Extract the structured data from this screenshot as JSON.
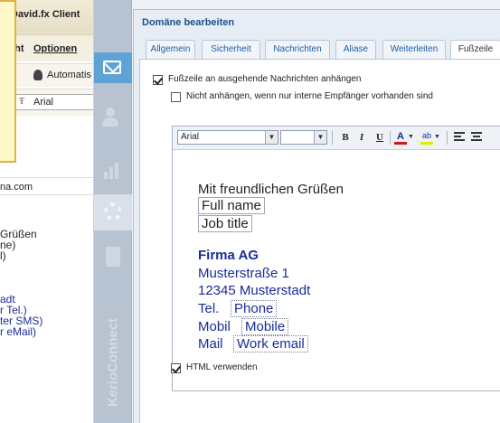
{
  "background_window": {
    "title": "David.fx Client",
    "menu": [
      "cht",
      "Optionen"
    ],
    "toolbar_label": "Automatis",
    "font_name": "Arial",
    "email_fragment": "na.com",
    "body_lines": [
      "Grüßen",
      "ne)",
      "l)",
      "adt",
      "r Tel.)",
      "ter SMS)",
      "r eMail)"
    ]
  },
  "nav": {
    "icons": [
      "mail-icon",
      "users-icon",
      "statistics-icon",
      "settings-icon",
      "documents-icon"
    ],
    "brand": "KerioConnect"
  },
  "dialog": {
    "title": "Domäne bearbeiten",
    "tabs": [
      "Allgemein",
      "Sicherheit",
      "Nachrichten",
      "Aliase",
      "Weiterleiten",
      "Fußzeile"
    ],
    "active_tab": "Fußzeile",
    "append_footer": {
      "label": "Fußzeile an ausgehende Nachrichten anhängen",
      "checked": true
    },
    "skip_internal": {
      "label": "Nicht anhängen, wenn nur interne Empfänger vorhanden sind",
      "checked": false
    },
    "use_html": {
      "label": "HTML verwenden",
      "checked": true
    }
  },
  "editor": {
    "font_select": "Arial",
    "size_select": "",
    "buttons": {
      "bold": "B",
      "italic": "I",
      "underline": "U",
      "font_color": "A",
      "highlight": "ab"
    },
    "greeting": "Mit freundlichen Grüßen",
    "full_name": "Full name",
    "job_title": "Job title",
    "company": "Firma AG",
    "street": "Musterstraße 1",
    "city": "12345 Musterstadt",
    "tel_label": "Tel.",
    "tel_value": "Phone",
    "mobile_label": "Mobil",
    "mobile_value": "Mobile",
    "mail_label": "Mail",
    "mail_value": "Work email"
  },
  "colors": {
    "accent_blue": "#5fa2d6",
    "signature_blue": "#1a2c9a",
    "note_border": "#e3b23c"
  }
}
